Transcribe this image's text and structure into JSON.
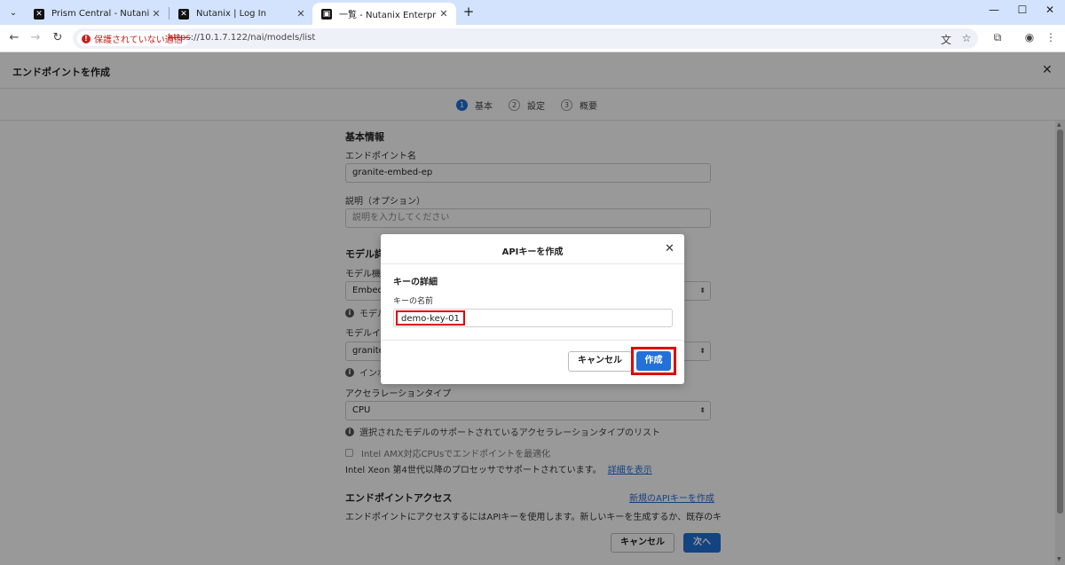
{
  "browser": {
    "tabs": [
      {
        "title": "Prism Central - Nutanix"
      },
      {
        "title": "Nutanix | Log In"
      },
      {
        "title": "一覧 - Nutanix Enterprise AI"
      }
    ],
    "security_chip": "保護されていない通信",
    "url_scheme": "https",
    "url_rest": "://10.1.7.122/nai/models/list"
  },
  "page": {
    "title": "エンドポイントを作成",
    "steps": [
      {
        "num": "1",
        "label": "基本"
      },
      {
        "num": "2",
        "label": "設定"
      },
      {
        "num": "3",
        "label": "概要"
      }
    ],
    "basic_info": {
      "section_title": "基本情報",
      "name_label": "エンドポイント名",
      "name_value": "granite-embed-ep",
      "desc_label": "説明（オプション）",
      "desc_placeholder": "説明を入力してください"
    },
    "model_details": {
      "section_title": "モデル詳細",
      "capability_label": "モデル機能",
      "capability_value": "Embedding",
      "capability_hint": "モデル",
      "instance_label": "モデルインスタンス",
      "instance_value": "granite-",
      "instance_hint": "インポ",
      "accel_label": "アクセラレーションタイプ",
      "accel_value": "CPU",
      "accel_hint": "選択されたモデルのサポートされているアクセラレーションタイプのリスト",
      "amx_label": "Intel AMX対応CPUsでエンドポイントを最適化",
      "xeon_note": "Intel Xeon 第4世代以降のプロセッサでサポートされています。",
      "details_link": "詳細を表示"
    },
    "access": {
      "section_title": "エンドポイントアクセス",
      "new_key_link": "新規のAPIキーを作成",
      "description": "エンドポイントにアクセスするにはAPIキーを使用します。新しいキーを生成するか、既存のキ"
    },
    "footer": {
      "cancel": "キャンセル",
      "next": "次へ"
    }
  },
  "modal": {
    "title": "APIキーを作成",
    "section_title": "キーの詳細",
    "key_name_label": "キーの名前",
    "key_name_value": "demo-key-01",
    "cancel": "キャンセル",
    "create": "作成"
  }
}
